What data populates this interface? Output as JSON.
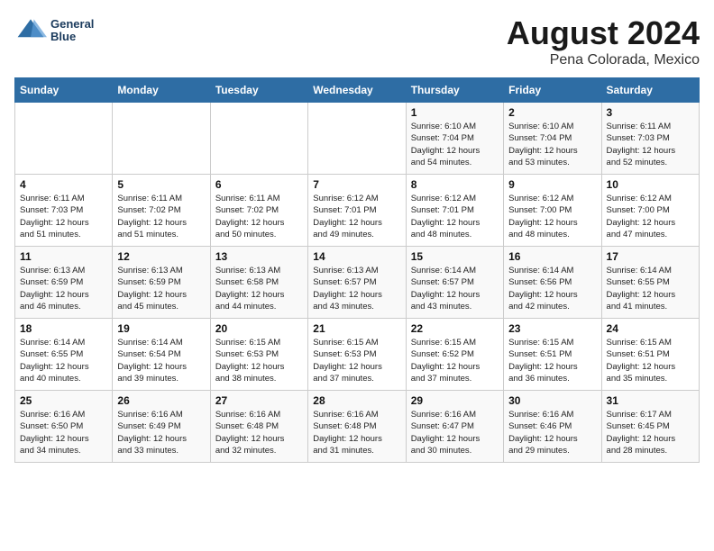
{
  "header": {
    "logo_line1": "General",
    "logo_line2": "Blue",
    "title": "August 2024",
    "subtitle": "Pena Colorada, Mexico"
  },
  "weekdays": [
    "Sunday",
    "Monday",
    "Tuesday",
    "Wednesday",
    "Thursday",
    "Friday",
    "Saturday"
  ],
  "weeks": [
    [
      {
        "day": "",
        "info": ""
      },
      {
        "day": "",
        "info": ""
      },
      {
        "day": "",
        "info": ""
      },
      {
        "day": "",
        "info": ""
      },
      {
        "day": "1",
        "info": "Sunrise: 6:10 AM\nSunset: 7:04 PM\nDaylight: 12 hours\nand 54 minutes."
      },
      {
        "day": "2",
        "info": "Sunrise: 6:10 AM\nSunset: 7:04 PM\nDaylight: 12 hours\nand 53 minutes."
      },
      {
        "day": "3",
        "info": "Sunrise: 6:11 AM\nSunset: 7:03 PM\nDaylight: 12 hours\nand 52 minutes."
      }
    ],
    [
      {
        "day": "4",
        "info": "Sunrise: 6:11 AM\nSunset: 7:03 PM\nDaylight: 12 hours\nand 51 minutes."
      },
      {
        "day": "5",
        "info": "Sunrise: 6:11 AM\nSunset: 7:02 PM\nDaylight: 12 hours\nand 51 minutes."
      },
      {
        "day": "6",
        "info": "Sunrise: 6:11 AM\nSunset: 7:02 PM\nDaylight: 12 hours\nand 50 minutes."
      },
      {
        "day": "7",
        "info": "Sunrise: 6:12 AM\nSunset: 7:01 PM\nDaylight: 12 hours\nand 49 minutes."
      },
      {
        "day": "8",
        "info": "Sunrise: 6:12 AM\nSunset: 7:01 PM\nDaylight: 12 hours\nand 48 minutes."
      },
      {
        "day": "9",
        "info": "Sunrise: 6:12 AM\nSunset: 7:00 PM\nDaylight: 12 hours\nand 48 minutes."
      },
      {
        "day": "10",
        "info": "Sunrise: 6:12 AM\nSunset: 7:00 PM\nDaylight: 12 hours\nand 47 minutes."
      }
    ],
    [
      {
        "day": "11",
        "info": "Sunrise: 6:13 AM\nSunset: 6:59 PM\nDaylight: 12 hours\nand 46 minutes."
      },
      {
        "day": "12",
        "info": "Sunrise: 6:13 AM\nSunset: 6:59 PM\nDaylight: 12 hours\nand 45 minutes."
      },
      {
        "day": "13",
        "info": "Sunrise: 6:13 AM\nSunset: 6:58 PM\nDaylight: 12 hours\nand 44 minutes."
      },
      {
        "day": "14",
        "info": "Sunrise: 6:13 AM\nSunset: 6:57 PM\nDaylight: 12 hours\nand 43 minutes."
      },
      {
        "day": "15",
        "info": "Sunrise: 6:14 AM\nSunset: 6:57 PM\nDaylight: 12 hours\nand 43 minutes."
      },
      {
        "day": "16",
        "info": "Sunrise: 6:14 AM\nSunset: 6:56 PM\nDaylight: 12 hours\nand 42 minutes."
      },
      {
        "day": "17",
        "info": "Sunrise: 6:14 AM\nSunset: 6:55 PM\nDaylight: 12 hours\nand 41 minutes."
      }
    ],
    [
      {
        "day": "18",
        "info": "Sunrise: 6:14 AM\nSunset: 6:55 PM\nDaylight: 12 hours\nand 40 minutes."
      },
      {
        "day": "19",
        "info": "Sunrise: 6:14 AM\nSunset: 6:54 PM\nDaylight: 12 hours\nand 39 minutes."
      },
      {
        "day": "20",
        "info": "Sunrise: 6:15 AM\nSunset: 6:53 PM\nDaylight: 12 hours\nand 38 minutes."
      },
      {
        "day": "21",
        "info": "Sunrise: 6:15 AM\nSunset: 6:53 PM\nDaylight: 12 hours\nand 37 minutes."
      },
      {
        "day": "22",
        "info": "Sunrise: 6:15 AM\nSunset: 6:52 PM\nDaylight: 12 hours\nand 37 minutes."
      },
      {
        "day": "23",
        "info": "Sunrise: 6:15 AM\nSunset: 6:51 PM\nDaylight: 12 hours\nand 36 minutes."
      },
      {
        "day": "24",
        "info": "Sunrise: 6:15 AM\nSunset: 6:51 PM\nDaylight: 12 hours\nand 35 minutes."
      }
    ],
    [
      {
        "day": "25",
        "info": "Sunrise: 6:16 AM\nSunset: 6:50 PM\nDaylight: 12 hours\nand 34 minutes."
      },
      {
        "day": "26",
        "info": "Sunrise: 6:16 AM\nSunset: 6:49 PM\nDaylight: 12 hours\nand 33 minutes."
      },
      {
        "day": "27",
        "info": "Sunrise: 6:16 AM\nSunset: 6:48 PM\nDaylight: 12 hours\nand 32 minutes."
      },
      {
        "day": "28",
        "info": "Sunrise: 6:16 AM\nSunset: 6:48 PM\nDaylight: 12 hours\nand 31 minutes."
      },
      {
        "day": "29",
        "info": "Sunrise: 6:16 AM\nSunset: 6:47 PM\nDaylight: 12 hours\nand 30 minutes."
      },
      {
        "day": "30",
        "info": "Sunrise: 6:16 AM\nSunset: 6:46 PM\nDaylight: 12 hours\nand 29 minutes."
      },
      {
        "day": "31",
        "info": "Sunrise: 6:17 AM\nSunset: 6:45 PM\nDaylight: 12 hours\nand 28 minutes."
      }
    ]
  ]
}
